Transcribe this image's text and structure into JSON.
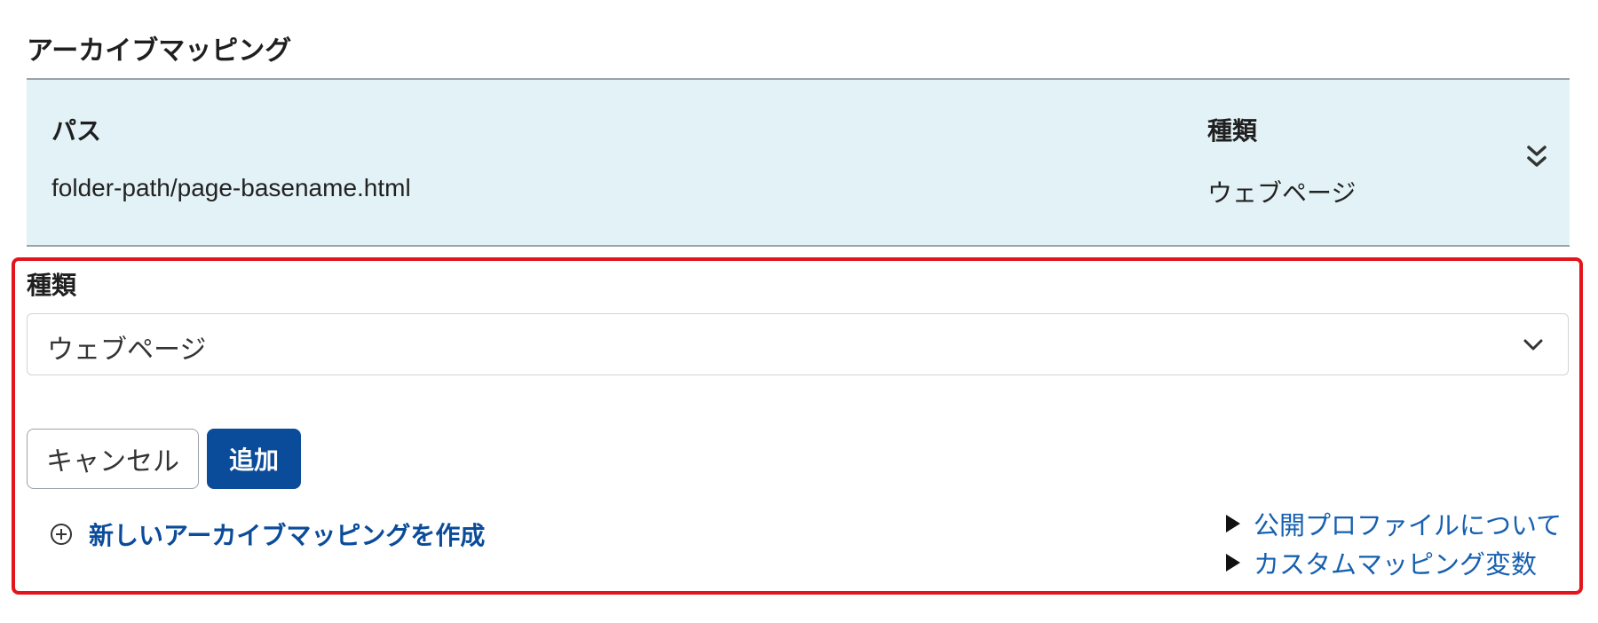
{
  "section": {
    "title": "アーカイブマッピング"
  },
  "table": {
    "headers": {
      "path": "パス",
      "type": "種類"
    },
    "row": {
      "path": "folder-path/page-basename.html",
      "type": "ウェブページ"
    },
    "expand_icon": "double-chevron-down-icon"
  },
  "form": {
    "type_label": "種類",
    "type_select": {
      "selected": "ウェブページ",
      "icon": "chevron-down-icon"
    },
    "cancel_label": "キャンセル",
    "add_label": "追加",
    "create_link": {
      "icon": "circle-plus-icon",
      "label": "新しいアーカイブマッピングを作成"
    },
    "help_links": [
      {
        "icon": "triangle-right-icon",
        "label": "公開プロファイルについて"
      },
      {
        "icon": "triangle-right-icon",
        "label": "カスタムマッピング変数"
      }
    ]
  },
  "colors": {
    "table_bg": "#e3f2f6",
    "primary": "#0b4c9a",
    "link": "#1660b0",
    "highlight": "#e3141c"
  }
}
